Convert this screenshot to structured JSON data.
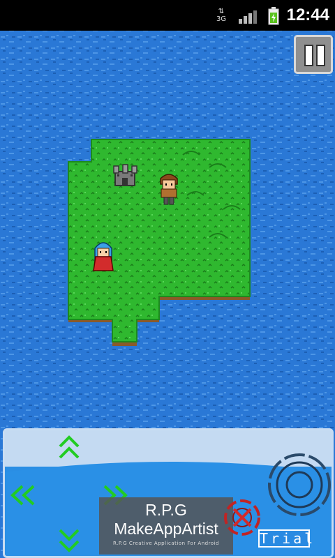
{
  "status_bar": {
    "time": "12:44",
    "network_type": "3G",
    "signal_icon": "signal-bars-icon",
    "battery_icon": "battery-charging-icon"
  },
  "game": {
    "terrain": [
      "ocean",
      "grass-island"
    ],
    "sprites": [
      "castle",
      "hero-brown-hair",
      "blue-haired-girl"
    ],
    "pause_icon": "pause-icon"
  },
  "controls": {
    "dpad_icons": [
      "up-arrow-icon",
      "down-arrow-icon",
      "left-arrow-icon",
      "right-arrow-icon"
    ],
    "cancel_icon": "cancel-x-icon",
    "action_icon": "action-ring-icon"
  },
  "banner": {
    "title": "R.P.G",
    "subtitle": "MakeAppArtist",
    "tagline": "R.P.G Creative Application For Android"
  },
  "trial_label": "Trial",
  "colors": {
    "ocean": "#2a78d6",
    "grass": "#2eb82e",
    "cliff": "#8a5a2a",
    "arrow": "#22cc22"
  }
}
